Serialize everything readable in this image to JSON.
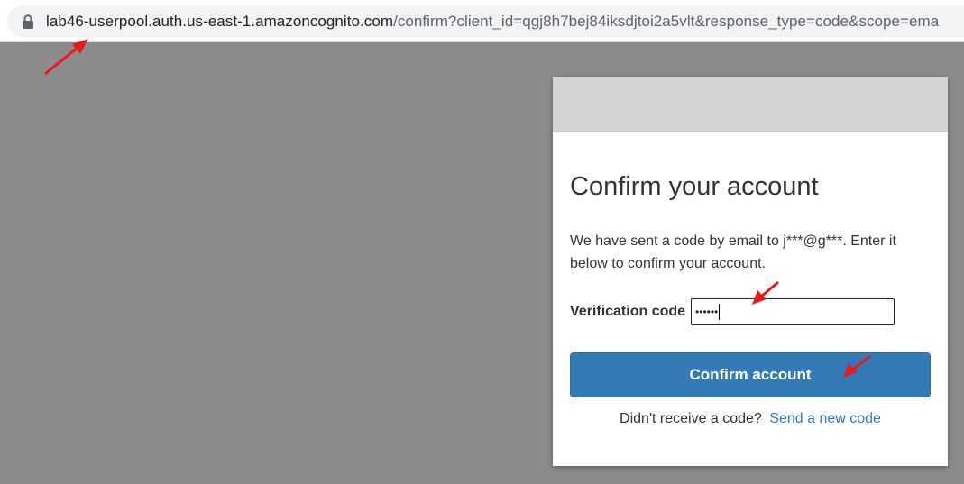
{
  "browser": {
    "url_host": "lab46-userpool.auth.us-east-1.amazoncognito.com",
    "url_rest": "/confirm?client_id=qgj8h7bej84iksdjtoi2a5vlt&response_type=code&scope=ema",
    "lock_icon": "lock-icon"
  },
  "modal": {
    "title": "Confirm your account",
    "description": "We have sent a code by email to j***@g***. Enter it below to confirm your account.",
    "code_label": "Verification code",
    "code_value": "••••••",
    "confirm_button": "Confirm account",
    "resend_prompt": "Didn't receive a code?",
    "resend_link": "Send a new code"
  },
  "colors": {
    "overlay": "#8c8c8c",
    "banner": "#d3d3d3",
    "button": "#337ab7",
    "link": "#337ab7",
    "annotation": "#e8191b"
  }
}
